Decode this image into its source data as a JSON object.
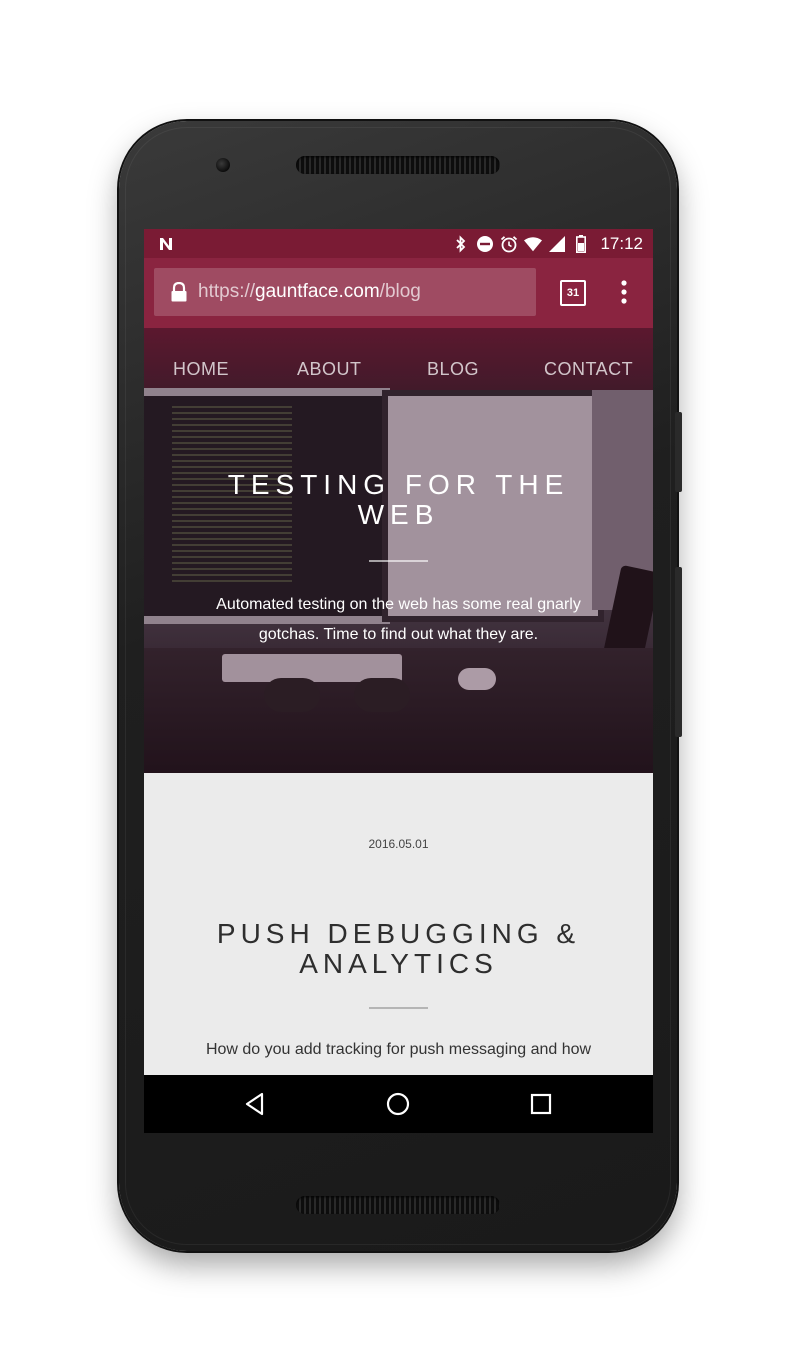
{
  "status_bar": {
    "time": "17:12",
    "icons": [
      "notification-n-icon",
      "bluetooth-icon",
      "do-not-disturb-icon",
      "alarm-icon",
      "wifi-icon",
      "cell-signal-icon",
      "battery-icon"
    ]
  },
  "browser": {
    "url_scheme": "https://",
    "url_host": "gauntface.com",
    "url_path": "/blog",
    "tab_count": "31",
    "theme_color": "#8a2440"
  },
  "site_nav": {
    "items": [
      {
        "label": "HOME"
      },
      {
        "label": "ABOUT"
      },
      {
        "label": "BLOG"
      },
      {
        "label": "CONTACT"
      }
    ]
  },
  "hero": {
    "title": "TESTING FOR THE WEB",
    "subtitle": "Automated testing on the web has some real gnarly gotchas. Time to find out what they are."
  },
  "post": {
    "date": "2016.05.01",
    "title": "PUSH DEBUGGING & ANALYTICS",
    "excerpt": "How do you add tracking for push messaging and how"
  },
  "nav_bar": {
    "buttons": [
      "back-icon",
      "home-icon",
      "recent-apps-icon"
    ]
  }
}
